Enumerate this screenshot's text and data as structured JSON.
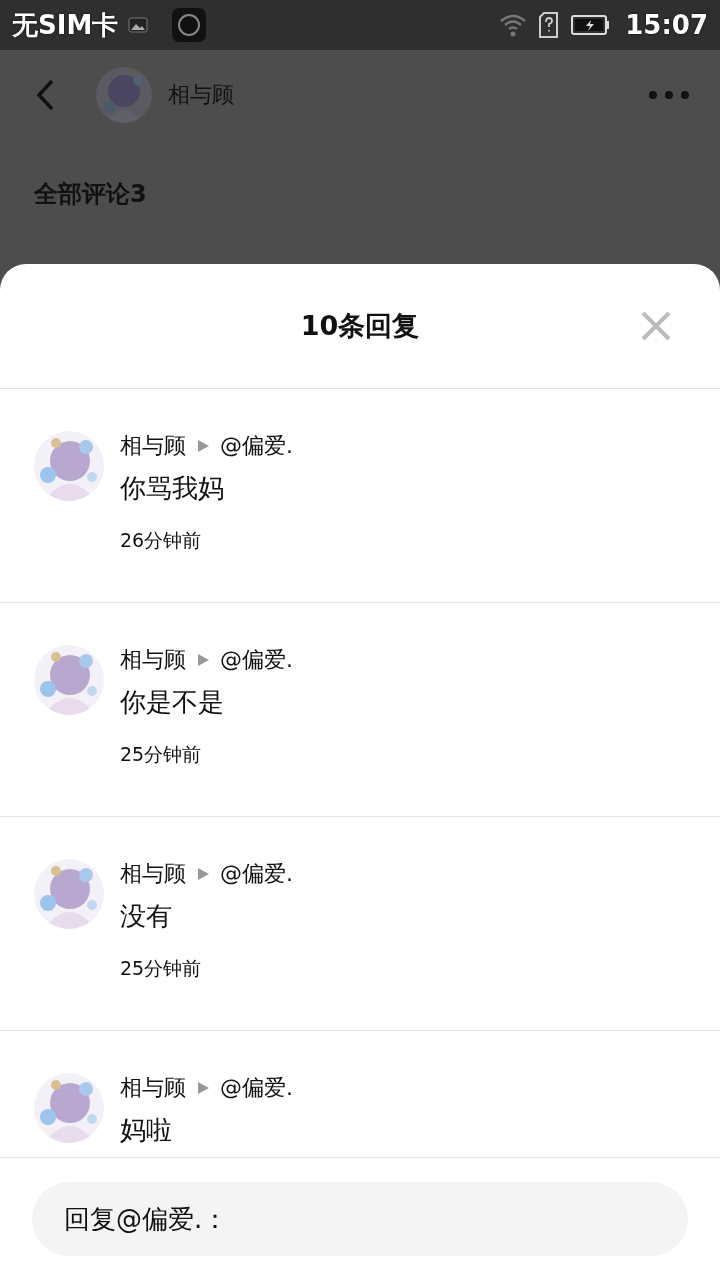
{
  "status_bar": {
    "carrier": "无SIM卡",
    "time": "15:07"
  },
  "header": {
    "name": "相与顾"
  },
  "section_title": "全部评论3",
  "sheet": {
    "title": "10条回复"
  },
  "replies": [
    {
      "author": "相与顾",
      "target": "@偏爱.",
      "text": "你骂我妈",
      "time": "26分钟前"
    },
    {
      "author": "相与顾",
      "target": "@偏爱.",
      "text": "你是不是",
      "time": "25分钟前"
    },
    {
      "author": "相与顾",
      "target": "@偏爱.",
      "text": "没有",
      "time": "25分钟前"
    },
    {
      "author": "相与顾",
      "target": "@偏爱.",
      "text": "妈啦"
    }
  ],
  "reply_field": {
    "value": "回复@偏爱.："
  }
}
